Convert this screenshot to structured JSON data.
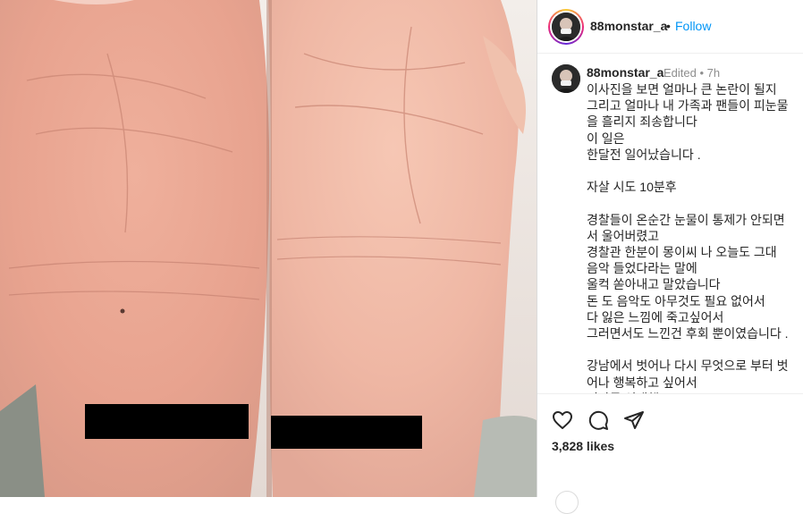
{
  "post": {
    "username": "88monstar_a",
    "follow_label": "Follow",
    "separator": "•"
  },
  "caption": {
    "username": "88monstar_a",
    "meta": "Edited • 7h",
    "text": "이사진을 보면 얼마나 큰 논란이 될지\n그리고 얼마나 내 가족과 팬들이 피눈물\n을 흘리지 죄송합니다\n이 일은\n한달전 일어났습니다 .\n\n자살 시도 10분후\n\n경찰들이 온순간 눈물이 통제가 안되면\n서 울어버렸고\n경찰관 한분이 몽이씨 나 오늘도 그대\n음악 들었다라는 말에\n울컥 쏟아내고 말았습니다\n돈 도 음악도 아무것도 필요 없어서\n다 잃은 느낌에 죽고싶어서\n그러면서도 느낀건 후회 뿐이였습니다 .\n\n강남에서 벗어나 다시 무엇으로 부터 벗\n어나 행복하고 싶어서\n이사를 선택했고"
  },
  "actions": {
    "like_icon": "heart-icon",
    "comment_icon": "comment-icon",
    "share_icon": "paper-plane-icon",
    "likes_text": "3,828 likes"
  },
  "colors": {
    "accent": "#0095f6",
    "text": "#262626",
    "muted": "#8e8e8e",
    "skin": "#e8a893"
  }
}
